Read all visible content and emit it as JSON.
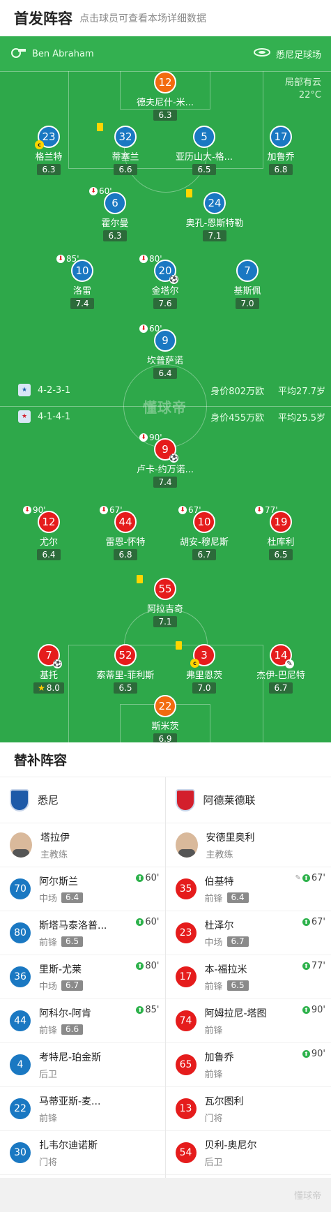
{
  "header": {
    "title": "首发阵容",
    "subtitle": "点击球员可查看本场详细数据"
  },
  "match": {
    "referee": "Ben Abraham",
    "venue": "悉尼足球场",
    "weather": "局部有云",
    "temp": "22°C"
  },
  "home": {
    "formation": "4-2-3-1",
    "value": "身价802万欧",
    "age": "平均27.7岁",
    "color": "#1a78c2"
  },
  "away": {
    "formation": "4-1-4-1",
    "value": "身价455万欧",
    "age": "平均25.5岁",
    "color": "#e51c1c"
  },
  "watermark": "懂球帝",
  "home_players": [
    {
      "num": "12",
      "name": "德夫尼什-米...",
      "rating": "6.3",
      "color": "orange"
    },
    {
      "num": "23",
      "name": "格兰特",
      "rating": "6.3",
      "color": "blue",
      "captain": "c"
    },
    {
      "num": "32",
      "name": "蒂塞兰",
      "rating": "6.6",
      "color": "blue",
      "yellow": true
    },
    {
      "num": "5",
      "name": "亚历山大-格...",
      "rating": "6.5",
      "color": "blue"
    },
    {
      "num": "17",
      "name": "加鲁乔",
      "rating": "6.8",
      "color": "blue"
    },
    {
      "num": "6",
      "name": "霍尔曼",
      "rating": "6.3",
      "color": "blue",
      "sub": "60'"
    },
    {
      "num": "24",
      "name": "奥孔-恩斯特勒",
      "rating": "7.1",
      "color": "blue",
      "yellow": true
    },
    {
      "num": "10",
      "name": "洛雷",
      "rating": "7.4",
      "color": "blue",
      "sub": "85'"
    },
    {
      "num": "20",
      "name": "金塔尔",
      "rating": "7.6",
      "color": "blue",
      "sub": "80'",
      "goal": true
    },
    {
      "num": "7",
      "name": "基斯佩",
      "rating": "7.0",
      "color": "blue"
    },
    {
      "num": "9",
      "name": "坎普萨诺",
      "rating": "6.4",
      "color": "blue",
      "sub": "60'"
    }
  ],
  "away_players": [
    {
      "num": "9",
      "name": "卢卡-约万诺...",
      "rating": "7.4",
      "color": "red",
      "sub": "90'",
      "goal": true
    },
    {
      "num": "12",
      "name": "尤尔",
      "rating": "6.4",
      "color": "red",
      "sub": "90'"
    },
    {
      "num": "44",
      "name": "雷恩-怀特",
      "rating": "6.8",
      "color": "red",
      "sub": "67'"
    },
    {
      "num": "10",
      "name": "胡安-穆尼斯",
      "rating": "6.7",
      "color": "red",
      "sub": "67'"
    },
    {
      "num": "19",
      "name": "杜库利",
      "rating": "6.5",
      "color": "red",
      "sub": "77'"
    },
    {
      "num": "55",
      "name": "阿拉吉奇",
      "rating": "7.1",
      "color": "red",
      "yellow": true
    },
    {
      "num": "7",
      "name": "基托",
      "rating": "8.0",
      "color": "red",
      "goal": true,
      "star": true
    },
    {
      "num": "52",
      "name": "索蒂里-菲利斯",
      "rating": "6.5",
      "color": "red"
    },
    {
      "num": "3",
      "name": "弗里恩茨",
      "rating": "7.0",
      "color": "red",
      "yellow": true,
      "captain": "c"
    },
    {
      "num": "14",
      "name": "杰伊-巴尼特",
      "rating": "6.7",
      "color": "red",
      "assist": true
    },
    {
      "num": "22",
      "name": "斯米茨",
      "rating": "6.9",
      "color": "orange"
    }
  ],
  "subs": {
    "title": "替补阵容",
    "home": {
      "team": "悉尼",
      "coach": "塔拉伊",
      "coach_role": "主教练",
      "players": [
        {
          "num": "70",
          "name": "阿尔斯兰",
          "pos": "中场",
          "rating": "6.4",
          "in": "60'"
        },
        {
          "num": "80",
          "name": "斯塔马泰洛普...",
          "pos": "前锋",
          "rating": "6.5",
          "in": "60'"
        },
        {
          "num": "36",
          "name": "里斯-尤莱",
          "pos": "中场",
          "rating": "6.7",
          "in": "80'"
        },
        {
          "num": "44",
          "name": "阿科尔-阿肯",
          "pos": "前锋",
          "rating": "6.6",
          "in": "85'"
        },
        {
          "num": "4",
          "name": "考特尼-珀金斯",
          "pos": "后卫"
        },
        {
          "num": "22",
          "name": "马蒂亚斯-麦...",
          "pos": "前锋"
        },
        {
          "num": "30",
          "name": "扎韦尔迪诺斯",
          "pos": "门将"
        }
      ]
    },
    "away": {
      "team": "阿德莱德联",
      "coach": "安德里奥利",
      "coach_role": "主教练",
      "players": [
        {
          "num": "35",
          "name": "伯基特",
          "pos": "前锋",
          "rating": "6.4",
          "in": "67'",
          "assist": true
        },
        {
          "num": "23",
          "name": "杜泽尔",
          "pos": "中场",
          "rating": "6.7",
          "in": "67'"
        },
        {
          "num": "17",
          "name": "本-福拉米",
          "pos": "前锋",
          "rating": "6.5",
          "in": "77'"
        },
        {
          "num": "74",
          "name": "阿姆拉尼-塔图",
          "pos": "前锋",
          "in": "90'"
        },
        {
          "num": "65",
          "name": "加鲁乔",
          "pos": "前锋",
          "in": "90'"
        },
        {
          "num": "13",
          "name": "瓦尔图利",
          "pos": "门将"
        },
        {
          "num": "54",
          "name": "贝利-奥尼尔",
          "pos": "后卫"
        }
      ]
    }
  },
  "footer": "懂球帝"
}
